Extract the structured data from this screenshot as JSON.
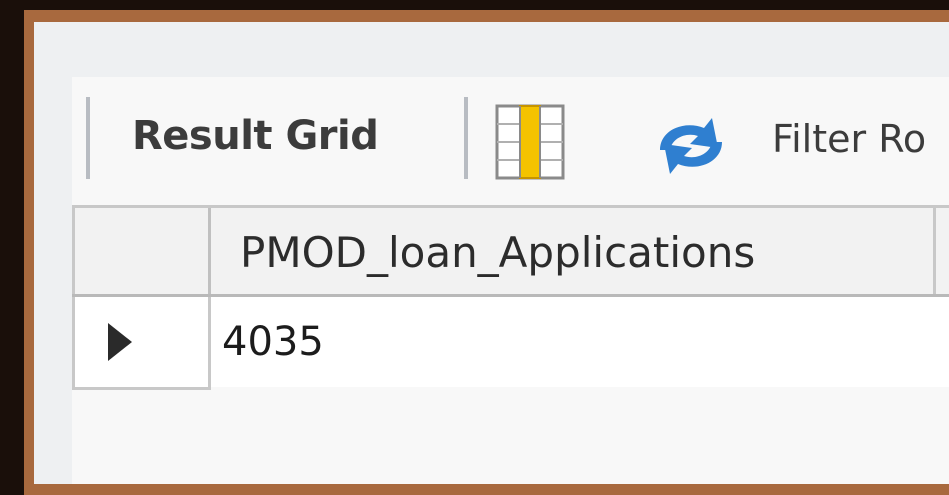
{
  "toolbar": {
    "result_grid_label": "Result Grid",
    "grid_icon": "grid-columns-icon",
    "refresh_icon": "refresh-icon",
    "filter_label": "Filter Ro"
  },
  "result_table": {
    "columns": [
      "PMOD_loan_Applications"
    ],
    "rows": [
      {
        "marker_icon": "row-pointer-arrow-icon",
        "cells": [
          "4035"
        ]
      }
    ]
  },
  "colors": {
    "border_brown": "#a8693e",
    "background": "#1a0f0a",
    "grid_icon_yellow": "#f4c300",
    "refresh_blue": "#2f7fd0"
  }
}
